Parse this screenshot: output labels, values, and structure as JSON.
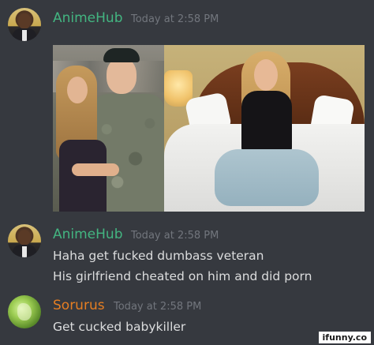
{
  "messages": [
    {
      "username": "AnimeHub",
      "username_color": "#43b581",
      "timestamp": "Today at 2:58 PM",
      "lines": [],
      "has_image": true
    },
    {
      "username": "AnimeHub",
      "username_color": "#43b581",
      "timestamp": "Today at 2:58 PM",
      "lines": [
        "Haha get fucked dumbass veteran",
        "His girlfriend cheated on him and did porn"
      ],
      "has_image": false
    },
    {
      "username": "Sorurus",
      "username_color": "#e67e22",
      "timestamp": "Today at 2:58 PM",
      "lines": [
        "Get cucked babykiller"
      ],
      "has_image": false
    }
  ],
  "watermark": "ifunny.co",
  "colors": {
    "background": "#36393f",
    "message_text": "#dcddde",
    "timestamp": "#72767d"
  }
}
